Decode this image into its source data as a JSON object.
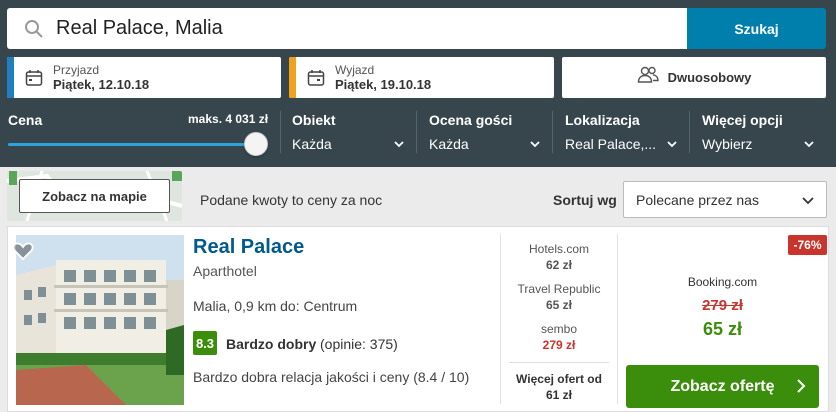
{
  "search": {
    "value": "Real Palace, Malia",
    "button": "Szukaj"
  },
  "checkin": {
    "label": "Przyjazd",
    "value": "Piątek, 12.10.18",
    "accent": "#1f7fbf"
  },
  "checkout": {
    "label": "Wyjazd",
    "value": "Piątek, 19.10.18",
    "accent": "#f0a11e"
  },
  "room": {
    "value": "Dwuosobowy"
  },
  "filters": {
    "price": {
      "label": "Cena",
      "max": "maks. 4 031 zł",
      "level": 1.0
    },
    "object": {
      "label": "Obiekt",
      "value": "Każda"
    },
    "rating": {
      "label": "Ocena gości",
      "value": "Każda"
    },
    "location": {
      "label": "Lokalizacja",
      "value": "Real Palace,..."
    },
    "more": {
      "label": "Więcej opcji",
      "value": "Wybierz"
    }
  },
  "toolbar": {
    "map_button": "Zobacz na mapie",
    "info": "Podane kwoty to ceny za noc",
    "sort_label": "Sortuj wg",
    "sort_value": "Polecane przez nas"
  },
  "hotel": {
    "name": "Real Palace",
    "type": "Aparthotel",
    "location": "Malia, 0,9 km do: Centrum",
    "rating_score": "8.3",
    "rating_text": "Bardzo dobry",
    "rating_count": "(opinie: 375)",
    "value_text": "Bardzo dobra relacja jakości i ceny (8.4 / 10)",
    "deals": [
      {
        "provider": "Hotels.com",
        "price": "62 zł",
        "highlight": false
      },
      {
        "provider": "Travel Republic",
        "price": "65 zł",
        "highlight": false
      },
      {
        "provider": "sembo",
        "price": "279 zł",
        "highlight": true
      }
    ],
    "more_offers_label": "Więcej ofert od",
    "more_offers_price": "61 zł",
    "discount": "-76%",
    "best_provider": "Booking.com",
    "old_price": "279 zł",
    "new_price": "65 zł",
    "offer_button": "Zobacz ofertę"
  },
  "icons": [
    "search-icon",
    "calendar-icon",
    "users-icon",
    "chevron-down-icon",
    "heart-icon",
    "chevron-right-icon"
  ],
  "colors": {
    "header": "#37454d",
    "primary": "#007fad",
    "green": "#3b8e0b",
    "red": "#c9342c"
  }
}
